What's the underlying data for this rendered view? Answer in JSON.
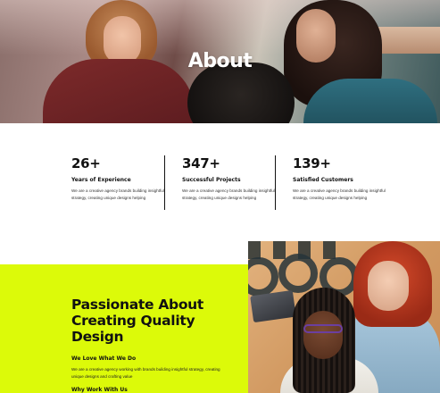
{
  "hero": {
    "title": "About"
  },
  "stats": [
    {
      "number": "26+",
      "label": "Years of Experience",
      "description": "We are a creative agency brands building insightful strategy, creating unique designs helping"
    },
    {
      "number": "347+",
      "label": "Successful Projects",
      "description": "We are a creative agency brands building insightful strategy, creating unique designs helping"
    },
    {
      "number": "139+",
      "label": "Satisfied Customers",
      "description": "We are a creative agency brands building insightful strategy, creating unique designs helping"
    }
  ],
  "feature": {
    "headline": "Passionate About Creating Quality Design",
    "subheading": "We Love What We Do",
    "paragraph": "We are a creative agency working with brands building insightful strategy, creating unique designs and crafting value",
    "next_heading": "Why Work With Us"
  },
  "colors": {
    "accent": "#dcfa09",
    "text": "#111111",
    "background": "#ffffff"
  }
}
